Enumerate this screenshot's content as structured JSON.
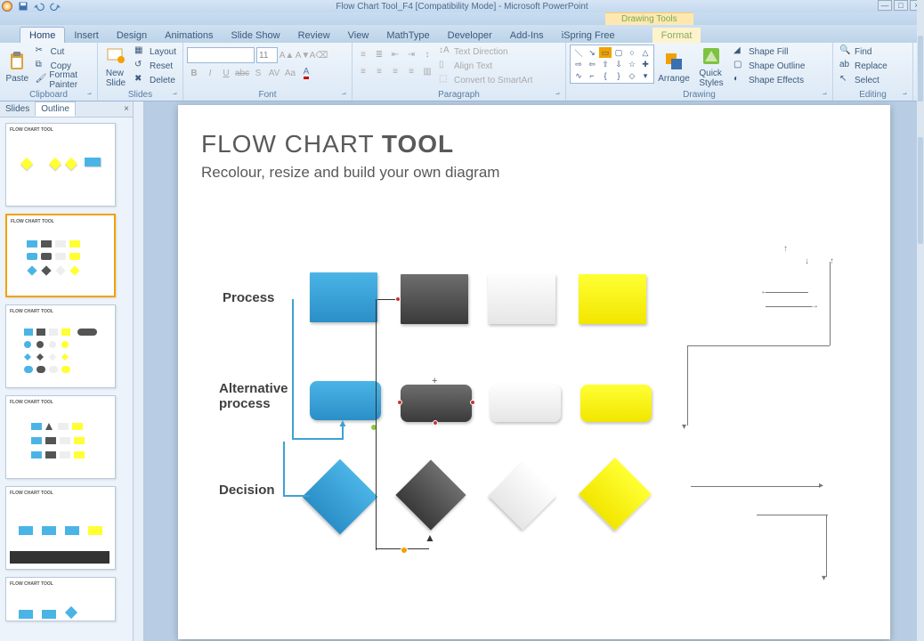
{
  "app": {
    "title": "Flow Chart Tool_F4 [Compatibility Mode] - Microsoft PowerPoint",
    "context_title": "Drawing Tools"
  },
  "tabs": [
    "Home",
    "Insert",
    "Design",
    "Animations",
    "Slide Show",
    "Review",
    "View",
    "MathType",
    "Developer",
    "Add-Ins",
    "iSpring Free",
    "Format"
  ],
  "active_tab": "Home",
  "ribbon": {
    "clipboard": {
      "label": "Clipboard",
      "paste": "Paste",
      "cut": "Cut",
      "copy": "Copy",
      "format_painter": "Format Painter"
    },
    "slides": {
      "label": "Slides",
      "new_slide": "New\nSlide",
      "layout": "Layout",
      "reset": "Reset",
      "delete": "Delete"
    },
    "font": {
      "label": "Font",
      "name_value": "",
      "size_value": "11"
    },
    "paragraph": {
      "label": "Paragraph",
      "text_direction": "Text Direction",
      "align_text": "Align Text",
      "convert_smartart": "Convert to SmartArt"
    },
    "drawing": {
      "label": "Drawing",
      "arrange": "Arrange",
      "quick_styles": "Quick\nStyles",
      "shape_fill": "Shape Fill",
      "shape_outline": "Shape Outline",
      "shape_effects": "Shape Effects"
    },
    "editing": {
      "label": "Editing",
      "find": "Find",
      "replace": "Replace",
      "select": "Select"
    }
  },
  "panel": {
    "slides_tab": "Slides",
    "outline_tab": "Outline"
  },
  "slide": {
    "title_pre": "FLOW CHART ",
    "title_bold": "TOOL",
    "subtitle": "Recolour, resize and build your own diagram",
    "row1": "Process",
    "row2": "Alternative process",
    "row3": "Decision"
  },
  "thumbs": [
    {
      "title": "FLOW CHART TOOL"
    },
    {
      "title": "FLOW CHART TOOL"
    },
    {
      "title": "FLOW CHART TOOL"
    },
    {
      "title": "FLOW CHART TOOL"
    },
    {
      "title": "FLOW CHART TOOL"
    },
    {
      "title": "FLOW CHART TOOL"
    }
  ]
}
